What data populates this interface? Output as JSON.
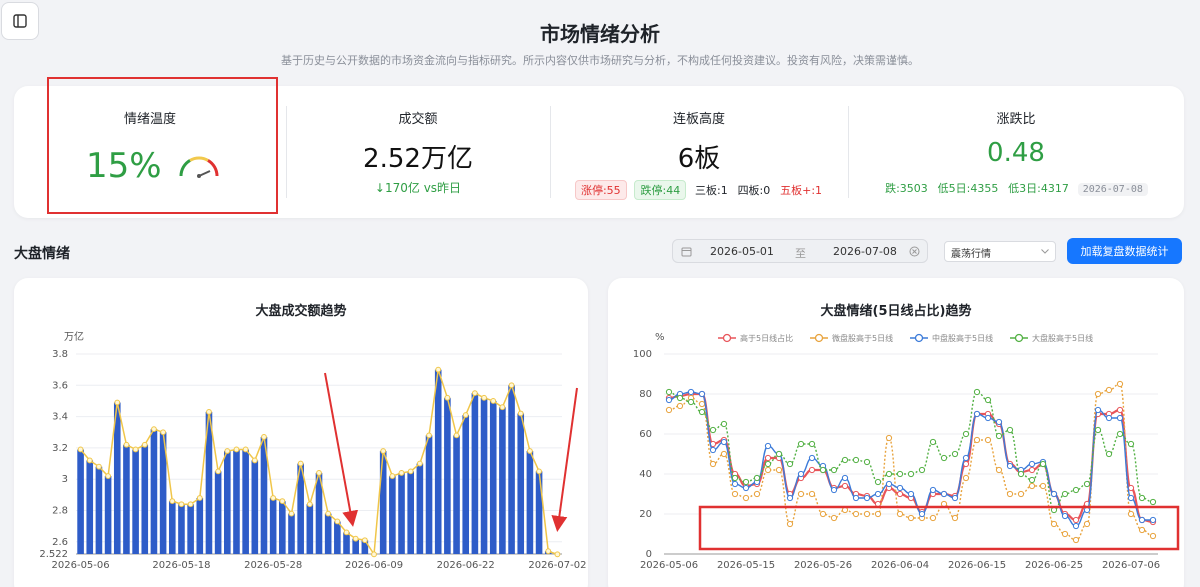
{
  "page": {
    "title": "市场情绪分析",
    "subtitle": "基于历史与公开数据的市场资金流向与指标研究。所示内容仅供市场研究与分析，不构成任何投资建议。投资有风险，决策需谨慎。"
  },
  "stats": {
    "sentiment": {
      "label": "情绪温度",
      "value": "15%",
      "gauge_level": 0.15
    },
    "turnover": {
      "label": "成交额",
      "value": "2.52万亿",
      "change": "↓170亿 vs昨日"
    },
    "board": {
      "label": "连板高度",
      "value": "6板",
      "limit_up": "涨停:55",
      "limit_down": "跌停:44",
      "three": "三板:1",
      "four": "四板:0",
      "five_plus": "五板+:1"
    },
    "ratio": {
      "label": "涨跌比",
      "value": "0.48",
      "fall": "跌:3503",
      "low5": "低5日:4355",
      "low3": "低3日:4317",
      "date": "2026-07-08"
    }
  },
  "section": {
    "title": "大盘情绪"
  },
  "filters": {
    "start": "2026-05-01",
    "to": "至",
    "end": "2026-07-08",
    "mode": "震荡行情",
    "load_label": "加载复盘数据统计"
  },
  "colors": {
    "accent": "#1677ff",
    "bar": "#2e5cc8",
    "up": "#e03131",
    "down": "#2f9e44"
  },
  "chart_data": [
    {
      "type": "bar",
      "title": "大盘成交额趋势",
      "ylabel": "万亿",
      "ylim": [
        2.522,
        3.8
      ],
      "yticks": [
        "3.8",
        "3.6",
        "3.4",
        "3.2",
        "3",
        "2.8",
        "2.6",
        "2.522"
      ],
      "xtick_labels": [
        "2026-05-06",
        "2026-05-18",
        "2026-05-28",
        "2026-06-09",
        "2026-06-22",
        "2026-07-02"
      ],
      "xtick_index": [
        0,
        11,
        21,
        32,
        42,
        52
      ],
      "values": [
        3.19,
        3.12,
        3.08,
        3.02,
        3.49,
        3.22,
        3.19,
        3.22,
        3.32,
        3.3,
        2.86,
        2.84,
        2.84,
        2.88,
        3.43,
        3.05,
        3.18,
        3.19,
        3.19,
        3.12,
        3.27,
        2.88,
        2.86,
        2.78,
        3.1,
        2.84,
        3.04,
        2.78,
        2.73,
        2.66,
        2.62,
        2.61,
        2.52,
        3.18,
        3.02,
        3.04,
        3.05,
        3.1,
        3.28,
        3.7,
        3.52,
        3.28,
        3.41,
        3.55,
        3.52,
        3.5,
        3.46,
        3.6,
        3.42,
        3.18,
        3.05,
        2.54,
        2.52
      ],
      "line_overlay": true
    },
    {
      "type": "line",
      "title": "大盘情绪(5日线占比)趋势",
      "ylabel": "%",
      "ylim": [
        0,
        100
      ],
      "yticks": [
        "100",
        "80",
        "60",
        "40",
        "20",
        "0"
      ],
      "xtick_labels": [
        "2026-05-06",
        "2026-05-15",
        "2026-05-26",
        "2026-06-04",
        "2026-06-15",
        "2026-06-25",
        "2026-07-06"
      ],
      "xtick_index": [
        0,
        7,
        14,
        21,
        28,
        35,
        42
      ],
      "legend_position": "top",
      "series": [
        {
          "name": "高于5日线占比",
          "color": "#e8555a",
          "values": [
            78,
            79,
            80,
            80,
            55,
            57,
            40,
            34,
            35,
            48,
            48,
            30,
            38,
            42,
            42,
            33,
            34,
            30,
            29,
            25,
            33,
            30,
            28,
            21,
            30,
            30,
            29,
            45,
            70,
            70,
            65,
            45,
            41,
            42,
            45,
            30,
            20,
            17,
            25,
            70,
            70,
            72,
            33,
            17,
            16
          ]
        },
        {
          "name": "微盘股高于5日线",
          "color": "#e8a33d",
          "values": [
            72,
            74,
            78,
            75,
            45,
            50,
            30,
            28,
            30,
            42,
            42,
            15,
            30,
            30,
            20,
            18,
            22,
            20,
            20,
            20,
            58,
            20,
            18,
            18,
            18,
            25,
            18,
            38,
            57,
            57,
            42,
            30,
            30,
            34,
            34,
            15,
            10,
            7,
            15,
            80,
            82,
            85,
            20,
            12,
            9
          ]
        },
        {
          "name": "中盘股高于5日线",
          "color": "#3c7bd9",
          "values": [
            77,
            80,
            81,
            80,
            52,
            56,
            35,
            33,
            36,
            54,
            50,
            28,
            40,
            48,
            44,
            32,
            38,
            28,
            28,
            30,
            35,
            33,
            30,
            20,
            32,
            30,
            28,
            48,
            70,
            68,
            66,
            44,
            42,
            45,
            46,
            30,
            19,
            14,
            22,
            72,
            68,
            68,
            28,
            17,
            17
          ]
        },
        {
          "name": "大盘股高于5日线",
          "color": "#52b043",
          "values": [
            81,
            78,
            76,
            71,
            62,
            65,
            38,
            36,
            38,
            45,
            50,
            45,
            55,
            55,
            42,
            42,
            47,
            47,
            46,
            36,
            40,
            40,
            40,
            42,
            56,
            48,
            50,
            60,
            81,
            77,
            59,
            62,
            40,
            37,
            45,
            22,
            30,
            32,
            35,
            62,
            50,
            60,
            55,
            28,
            26
          ]
        }
      ]
    }
  ]
}
